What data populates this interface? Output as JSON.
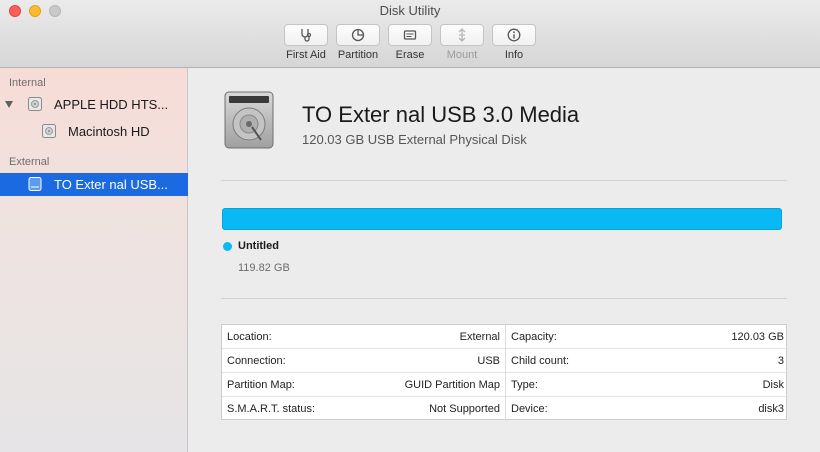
{
  "window": {
    "title": "Disk Utility"
  },
  "toolbar": [
    {
      "label": "First Aid",
      "icon": "stethoscope-icon",
      "enabled": true
    },
    {
      "label": "Partition",
      "icon": "pie-icon",
      "enabled": true
    },
    {
      "label": "Erase",
      "icon": "eraser-icon",
      "enabled": true
    },
    {
      "label": "Mount",
      "icon": "mount-icon",
      "enabled": false
    },
    {
      "label": "Info",
      "icon": "info-icon",
      "enabled": true
    }
  ],
  "sidebar": {
    "internal_label": "Internal",
    "external_label": "External",
    "items": [
      {
        "label": "APPLE HDD HTS..."
      },
      {
        "label": "Macintosh HD"
      },
      {
        "label": "TO Exter nal USB..."
      }
    ]
  },
  "disk": {
    "name": "TO Exter nal USB 3.0 Media",
    "subtitle": "120.03 GB USB External Physical Disk"
  },
  "usage": {
    "color": "#08b9f4",
    "partition_name": "Untitled",
    "partition_size": "119.82 GB"
  },
  "info_left": [
    {
      "key": "Location:",
      "value": "External"
    },
    {
      "key": "Connection:",
      "value": "USB"
    },
    {
      "key": "Partition Map:",
      "value": "GUID Partition Map"
    },
    {
      "key": "S.M.A.R.T. status:",
      "value": "Not Supported"
    }
  ],
  "info_right": [
    {
      "key": "Capacity:",
      "value": "120.03 GB"
    },
    {
      "key": "Child count:",
      "value": "3"
    },
    {
      "key": "Type:",
      "value": "Disk"
    },
    {
      "key": "Device:",
      "value": "disk3"
    }
  ]
}
